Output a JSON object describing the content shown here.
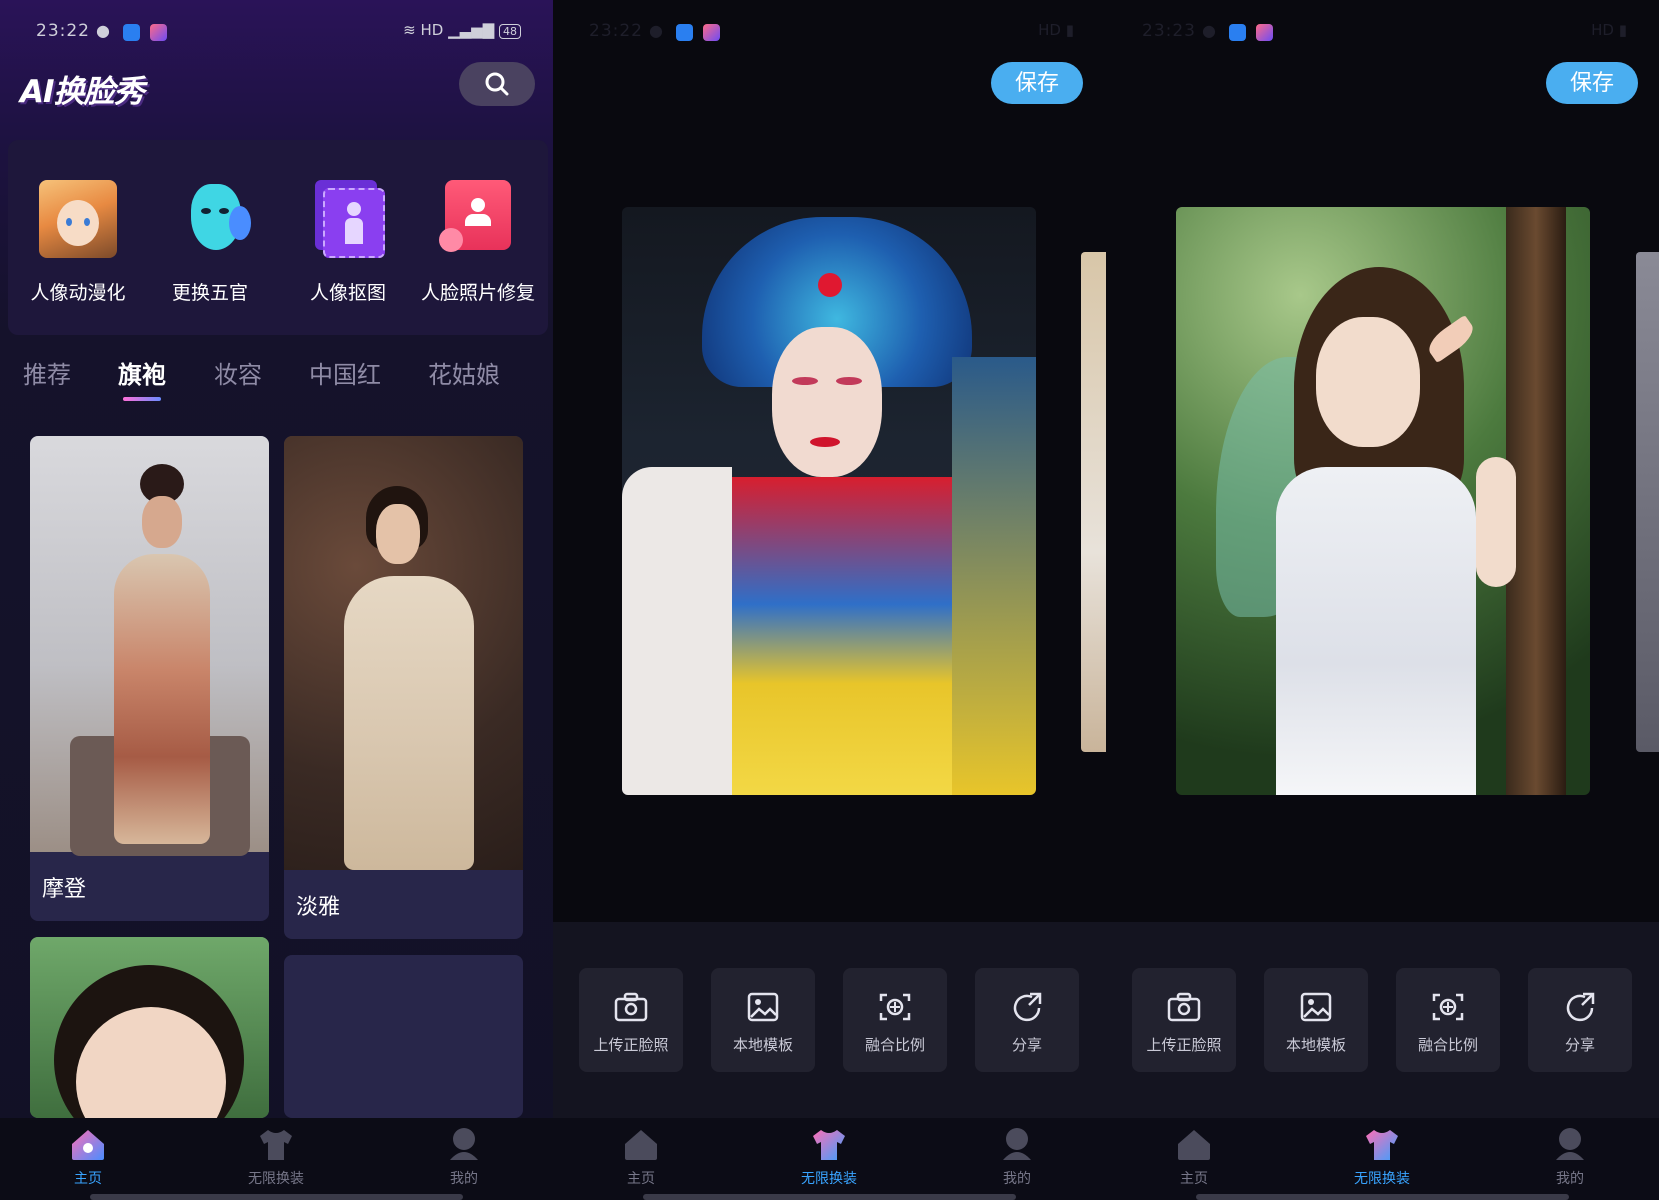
{
  "status_bar": {
    "time": "23:22",
    "time_s3": "23:23",
    "network": "HD",
    "battery": "48"
  },
  "home": {
    "app_logo": "AI换脸秀",
    "features": [
      {
        "label": "人像动漫化",
        "icon": "anime-portrait-icon"
      },
      {
        "label": "更换五官",
        "icon": "face-mask-icon"
      },
      {
        "label": "人像抠图",
        "icon": "cutout-icon"
      },
      {
        "label": "人脸照片修复",
        "icon": "photo-repair-icon"
      }
    ],
    "tabs": [
      "推荐",
      "旗袍",
      "妆容",
      "中国红",
      "花姑娘"
    ],
    "active_tab": "旗袍",
    "cards": [
      {
        "caption": "摩登"
      },
      {
        "caption": "淡雅"
      }
    ]
  },
  "editor": {
    "save_label": "保存",
    "tools": [
      {
        "label": "上传正脸照",
        "icon": "camera-icon"
      },
      {
        "label": "本地模板",
        "icon": "image-icon"
      },
      {
        "label": "融合比例",
        "icon": "face-scan-icon"
      },
      {
        "label": "分享",
        "icon": "share-icon"
      }
    ]
  },
  "nav": [
    {
      "label": "主页",
      "icon": "home-icon"
    },
    {
      "label": "无限换装",
      "icon": "outfit-icon"
    },
    {
      "label": "我的",
      "icon": "profile-icon"
    }
  ],
  "colors": {
    "accent": "#39a4ff",
    "save_button": "#4aaef0",
    "tab_underline": "#ff6fd8"
  }
}
